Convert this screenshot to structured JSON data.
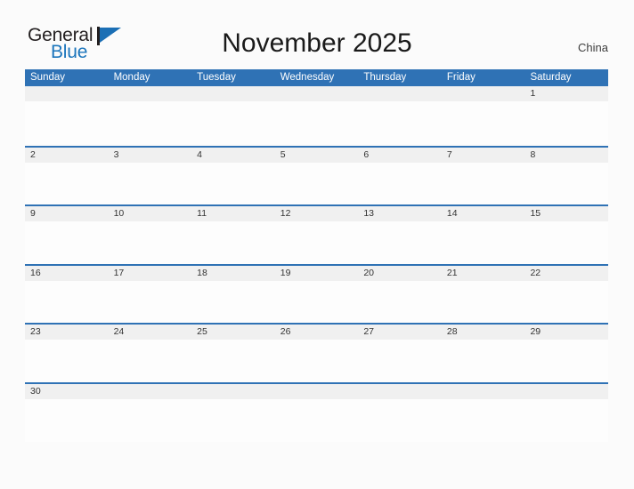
{
  "brand": {
    "word_one": "General",
    "word_two": "Blue",
    "flag_icon": "triangle-flag-icon"
  },
  "header": {
    "title": "November 2025",
    "country": "China"
  },
  "calendar": {
    "weekdays": [
      "Sunday",
      "Monday",
      "Tuesday",
      "Wednesday",
      "Thursday",
      "Friday",
      "Saturday"
    ],
    "weeks": [
      [
        "",
        "",
        "",
        "",
        "",
        "",
        "1"
      ],
      [
        "2",
        "3",
        "4",
        "5",
        "6",
        "7",
        "8"
      ],
      [
        "9",
        "10",
        "11",
        "12",
        "13",
        "14",
        "15"
      ],
      [
        "16",
        "17",
        "18",
        "19",
        "20",
        "21",
        "22"
      ],
      [
        "23",
        "24",
        "25",
        "26",
        "27",
        "28",
        "29"
      ],
      [
        "30",
        "",
        "",
        "",
        "",
        "",
        ""
      ]
    ]
  },
  "colors": {
    "header_blue": "#2f72b5",
    "brand_blue": "#1b75bc",
    "date_band_gray": "#f0f0f0",
    "page_background": "#fbfbfb",
    "text_dark": "#231f20"
  }
}
